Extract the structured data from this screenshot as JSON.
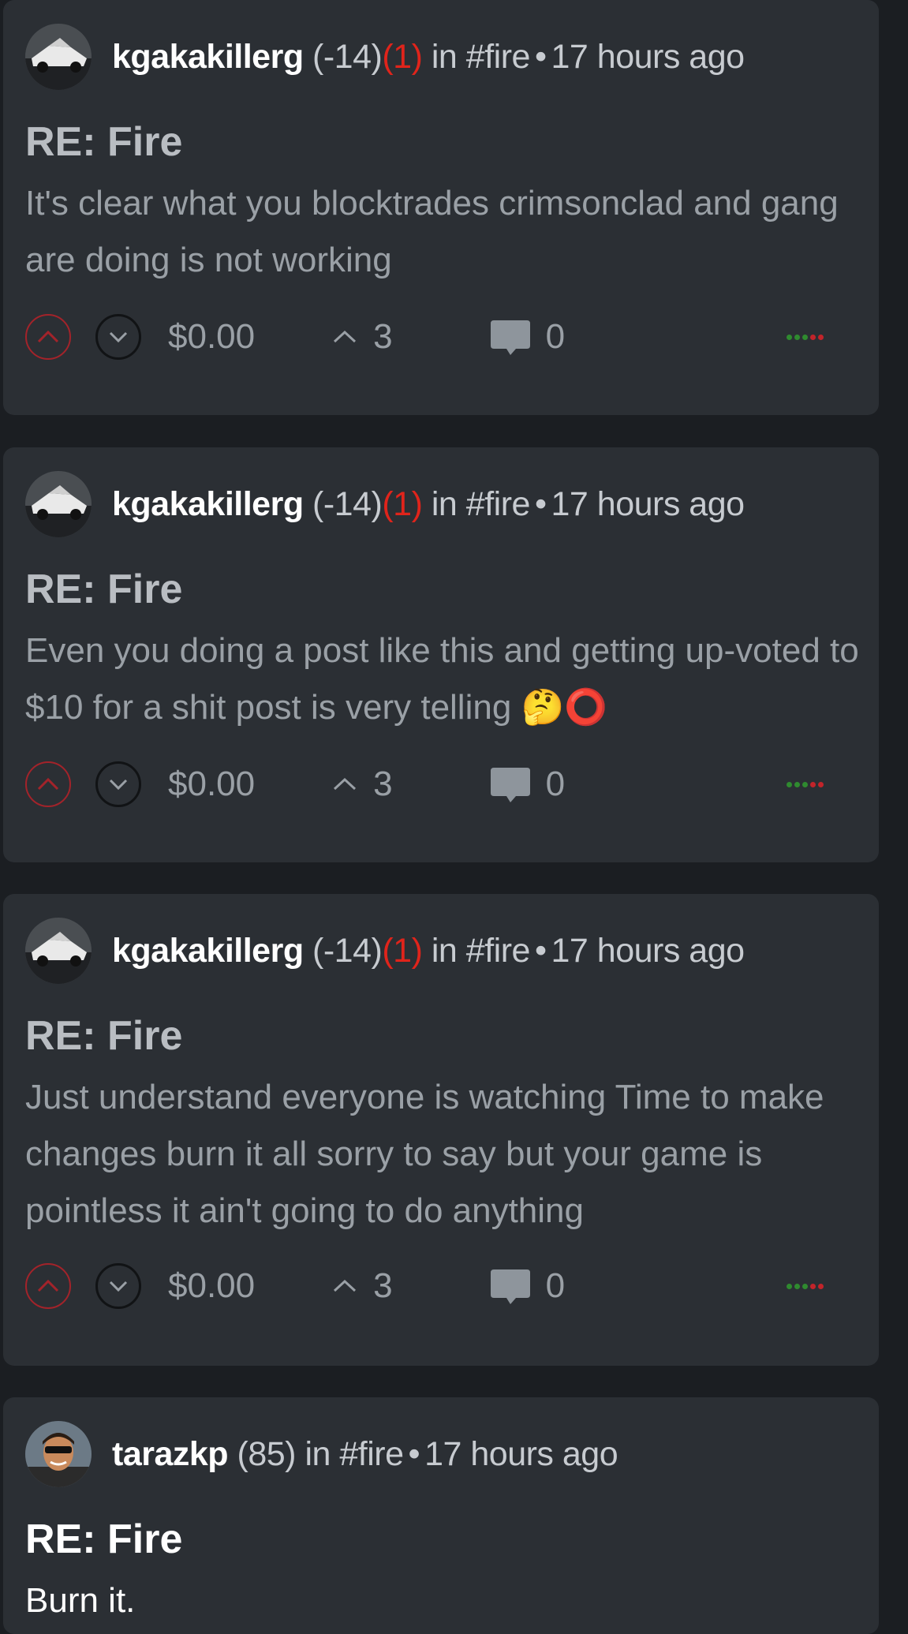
{
  "colors": {
    "flag": "#e0241b",
    "upvote": "#a3232a",
    "bar_green": "#2f8a2f",
    "bar_red": "#c2242a"
  },
  "posts": [
    {
      "author": "kgakakillerg",
      "rep": "(-14)",
      "flag": "(1)",
      "in_text": "in",
      "category": "#fire",
      "separator": "•",
      "time": "17 hours ago",
      "title": "RE: Fire",
      "body": "It's clear what you blocktrades crimsonclad and gang are doing is not working",
      "payout": "$0.00",
      "votes": "3",
      "replies": "0",
      "vote_bar": [
        "green",
        "green",
        "green",
        "red",
        "red"
      ]
    },
    {
      "author": "kgakakillerg",
      "rep": "(-14)",
      "flag": "(1)",
      "in_text": "in",
      "category": "#fire",
      "separator": "•",
      "time": "17 hours ago",
      "title": "RE: Fire",
      "body": "Even you doing a post like this and getting up-voted to $10 for a shit post is very telling 🤔⭕",
      "payout": "$0.00",
      "votes": "3",
      "replies": "0",
      "vote_bar": [
        "green",
        "green",
        "green",
        "red",
        "red"
      ]
    },
    {
      "author": "kgakakillerg",
      "rep": "(-14)",
      "flag": "(1)",
      "in_text": "in",
      "category": "#fire",
      "separator": "•",
      "time": "17 hours ago",
      "title": "RE: Fire",
      "body": "Just understand everyone is watching Time to make changes burn it all sorry to say but your game is pointless it ain't going to do anything",
      "payout": "$0.00",
      "votes": "3",
      "replies": "0",
      "vote_bar": [
        "green",
        "green",
        "green",
        "red",
        "red"
      ]
    },
    {
      "author": "tarazkp",
      "rep": "(85)",
      "in_text": "in",
      "category": "#fire",
      "separator": "•",
      "time": "17 hours ago",
      "title": "RE: Fire",
      "body": "Burn it."
    }
  ],
  "icons": {
    "upvote": "chevron-up-icon",
    "downvote": "chevron-down-icon",
    "votes": "caret-up-icon",
    "replies": "comment-icon"
  }
}
